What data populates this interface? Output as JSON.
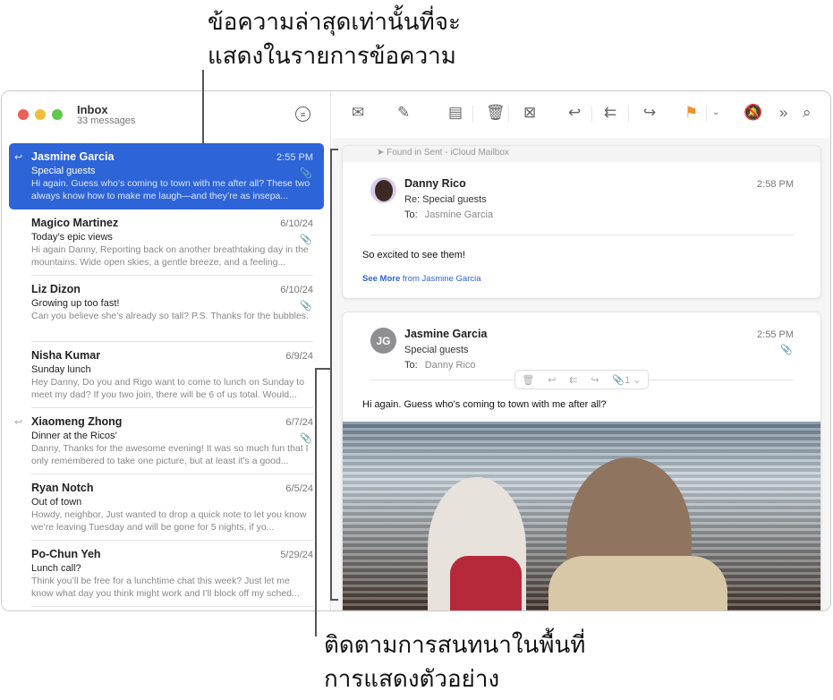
{
  "callouts": {
    "top": [
      "ข้อความล่าสุดเท่านั้นที่จะ",
      "แสดงในรายการข้อความ"
    ],
    "bottom": [
      "ติดตามการสนทนาในพื้นที่",
      "การแสดงตัวอย่าง"
    ]
  },
  "mailbox": {
    "title": "Inbox",
    "count": "33 messages"
  },
  "messages": [
    {
      "from": "Jasmine Garcia",
      "date": "2:55 PM",
      "subject": "Special guests",
      "preview": "Hi again. Guess who’s coming to town with me after all? These two always know how to make me laugh—and they’re as insepa...",
      "attachment": true,
      "replied": true,
      "selected": true
    },
    {
      "from": "Magico Martinez",
      "date": "6/10/24",
      "subject": "Today’s epic views",
      "preview": "Hi again Danny, Reporting back on another breathtaking day in the mountains. Wide open skies, a gentle breeze, and a feeling...",
      "attachment": true
    },
    {
      "from": "Liz Dizon",
      "date": "6/10/24",
      "subject": "Growing up too fast!",
      "preview": "Can you believe she’s already so tall? P.S. Thanks for the bubbles.",
      "attachment": true
    },
    {
      "from": "Nisha Kumar",
      "date": "6/9/24",
      "subject": "Sunday lunch",
      "preview": "Hey Danny, Do you and Rigo want to come to lunch on Sunday to meet my dad? If you two join, there will be 6 of us total. Would..."
    },
    {
      "from": "Xiaomeng Zhong",
      "date": "6/7/24",
      "subject": "Dinner at the Ricos’",
      "preview": "Danny, Thanks for the awesome evening! It was so much fun that I only remembered to take one picture, but at least it’s a good...",
      "attachment": true,
      "replied": true
    },
    {
      "from": "Ryan Notch",
      "date": "6/5/24",
      "subject": "Out of town",
      "preview": "Howdy, neighbor, Just wanted to drop a quick note to let you know we’re leaving Tuesday and will be gone for 5 nights, if yo..."
    },
    {
      "from": "Po-Chun Yeh",
      "date": "5/29/24",
      "subject": "Lunch call?",
      "preview": "Think you’ll be free for a lunchtime chat this week? Just let me know what day you think might work and I’ll block off my sched..."
    }
  ],
  "toolbar": [
    "envelope-icon",
    "compose-icon",
    "archive-icon",
    "trash-icon",
    "junk-icon",
    "reply-icon",
    "reply-all-icon",
    "forward-icon",
    "flag-icon",
    "chevron-down-icon",
    "mute-icon",
    "more-icon",
    "search-icon"
  ],
  "flag_color": "#f0922e",
  "accent": "#2d64d8",
  "thread": [
    {
      "found": "Found in Sent - iCloud Mailbox",
      "from": "Danny Rico",
      "subject": "Re: Special guests",
      "to_label": "To:",
      "to": "Jasmine Garcia",
      "time": "2:58 PM",
      "body": "So excited to see them!",
      "see_more": "See More",
      "see_more_from": "from Jasmine Garcia"
    },
    {
      "initials": "JG",
      "from": "Jasmine Garcia",
      "subject": "Special guests",
      "to_label": "To:",
      "to": "Danny Rico",
      "time": "2:55 PM",
      "body": "Hi again. Guess who’s coming to town with me after all?",
      "attachment_count": "1"
    }
  ]
}
